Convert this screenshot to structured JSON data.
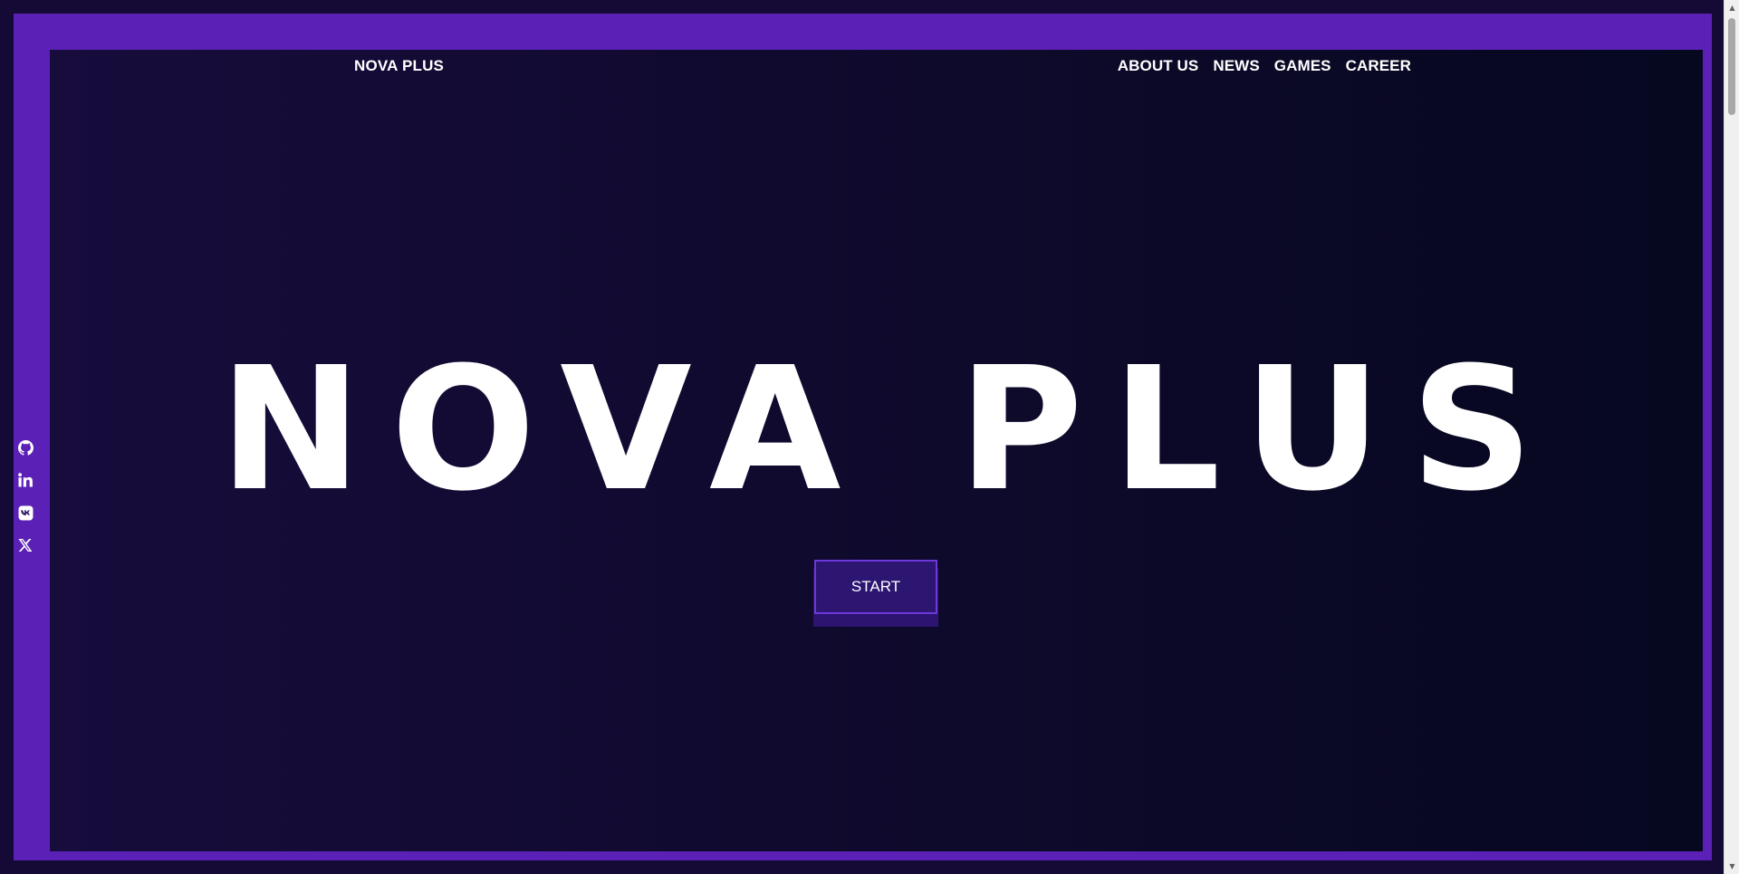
{
  "header": {
    "brand": "NOVA PLUS",
    "nav": [
      {
        "label": "ABOUT US"
      },
      {
        "label": "NEWS"
      },
      {
        "label": "GAMES"
      },
      {
        "label": "CAREER"
      }
    ]
  },
  "hero": {
    "title": "NOVA PLUS",
    "start_label": "START"
  },
  "social": {
    "icons": [
      "github-icon",
      "linkedin-icon",
      "vk-icon",
      "x-icon"
    ]
  },
  "scrollbar": {
    "up_glyph": "▲",
    "down_glyph": "▼"
  },
  "colors": {
    "frame": "#5b21b6",
    "background": "#140a35",
    "button": "#2d1572",
    "button_border": "#6d38d9",
    "text": "#ffffff"
  }
}
